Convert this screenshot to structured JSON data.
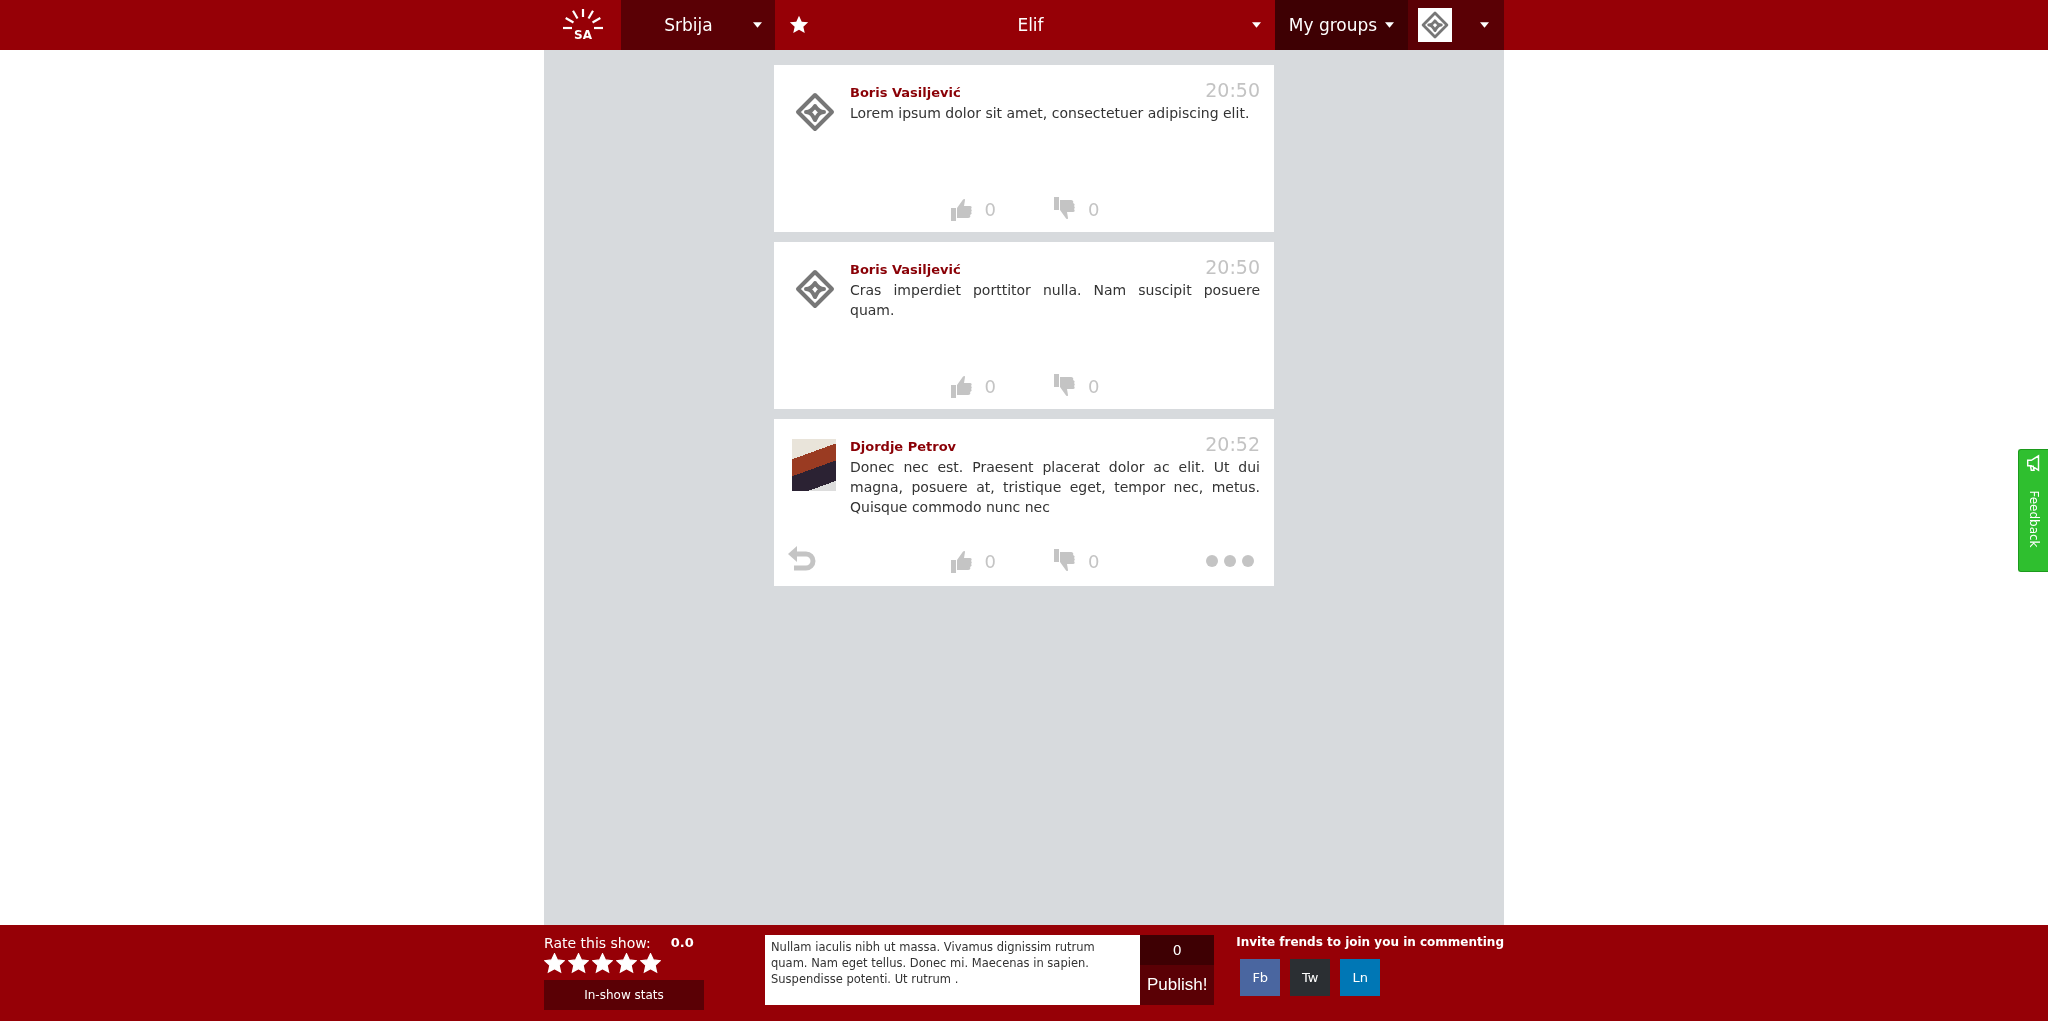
{
  "header": {
    "logo_text": "SA",
    "country": "Srbija",
    "show": "Elif",
    "groups": "My groups"
  },
  "posts": [
    {
      "author": "Boris Vasiljević",
      "time": "20:50",
      "text": "Lorem ipsum dolor sit amet, consectetuer adipiscing elit.",
      "kind": "logo_avatar",
      "likes": "0",
      "dislikes": "0",
      "reply": false,
      "more": false
    },
    {
      "author": "Boris Vasiljević",
      "time": "20:50",
      "text": "Cras imperdiet porttitor nulla. Nam suscipit posuere quam.",
      "kind": "logo_avatar",
      "likes": "0",
      "dislikes": "0",
      "reply": false,
      "more": false
    },
    {
      "author": "Djordje Petrov",
      "time": "20:52",
      "text": "Donec nec est. Praesent placerat dolor ac elit. Ut dui magna, posuere at, tristique eget, tempor nec, metus. Quisque commodo nunc nec",
      "kind": "photo_avatar",
      "likes": "0",
      "dislikes": "0",
      "reply": true,
      "more": true
    }
  ],
  "footer": {
    "rate_label": "Rate this show:",
    "rating": "0.0",
    "stars": 5,
    "stats_button": "In-show stats",
    "comment": "Nullam iaculis nibh ut massa. Vivamus dignissim rutrum quam. Nam eget tellus. Donec mi. Maecenas in sapien. Suspendisse potenti. Ut rutrum .",
    "counter": "0",
    "publish": "Publish!",
    "invite": "Invite frends to join you in commenting",
    "share": [
      {
        "label": "Fb",
        "color": "#4a66a0"
      },
      {
        "label": "Tw",
        "color": "#2b2f33"
      },
      {
        "label": "Ln",
        "color": "#0077b5"
      }
    ]
  },
  "feedback": {
    "label": "Feedback"
  }
}
